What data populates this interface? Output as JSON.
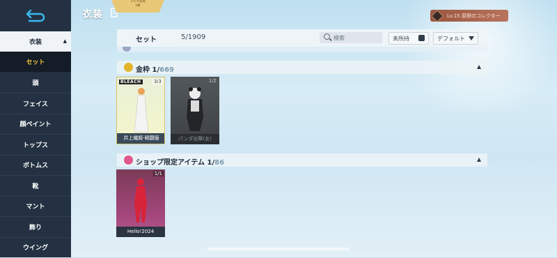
{
  "header": {
    "title": "衣装",
    "ribbon_line1": "マルチ鉛券",
    "ribbon_line2": "1枚",
    "collector": "Lv.15 原野のコレクター"
  },
  "sidebar": {
    "category": "衣装",
    "items": [
      {
        "label": "セット",
        "active": true
      },
      {
        "label": "頭"
      },
      {
        "label": "フェイス"
      },
      {
        "label": "顔ペイント"
      },
      {
        "label": "トップス"
      },
      {
        "label": "ボトムス"
      },
      {
        "label": "靴"
      },
      {
        "label": "マント"
      },
      {
        "label": "飾り"
      },
      {
        "label": "ウイング"
      }
    ]
  },
  "toolbar": {
    "label": "セット",
    "count": "5/1909",
    "search_placeholder": "検索",
    "unowned": "未所持",
    "sort": "デフォルト"
  },
  "sections": [
    {
      "name": "金枠",
      "owned": "1/",
      "total": "669",
      "icon": "gold-coin-icon",
      "color": "#e2b52a",
      "cards": [
        {
          "name": "井上織姫·戦闘服",
          "tag": "3/3",
          "style": "gold",
          "logo": "BLEACH"
        },
        {
          "name": "パンダ出撃(女)",
          "tag": "1/2",
          "style": "dark"
        }
      ]
    },
    {
      "name": "ショップ限定アイテム",
      "owned": "1/",
      "total": "86",
      "icon": "shop-gem-icon",
      "color": "#e0588a",
      "cards": [
        {
          "name": "Hello!2024",
          "tag": "1/1",
          "style": "pink"
        }
      ]
    }
  ]
}
